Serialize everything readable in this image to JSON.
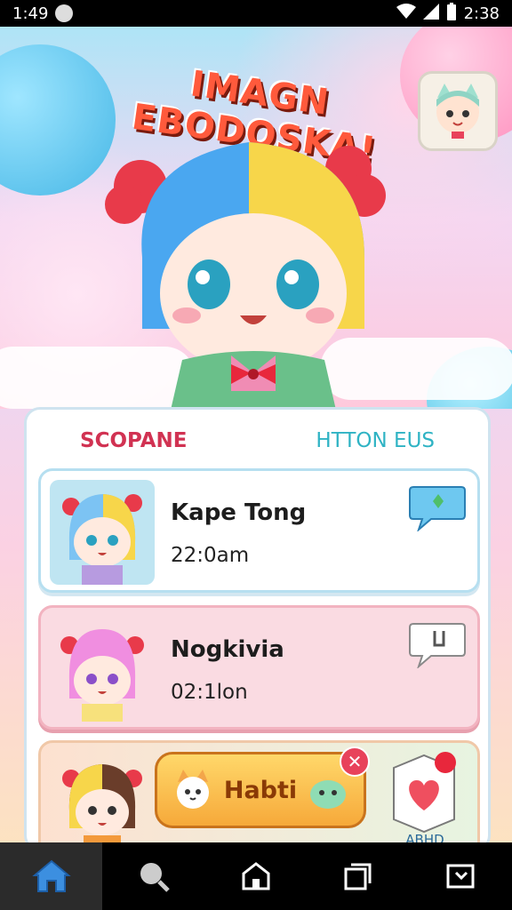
{
  "status_bar": {
    "time": "1:49",
    "time_right": "2:38"
  },
  "hero": {
    "title": "IMAGN EBODOSKA!",
    "avatar_corner_icon": "cat-avatar-icon"
  },
  "tabs": [
    {
      "label": "SCOPANE"
    },
    {
      "label": "HTTON EUS"
    }
  ],
  "items": [
    {
      "name": "Kape Tong",
      "time": "22:0am",
      "action_icon": "chat-bubble-icon"
    },
    {
      "name": "Nogkivia",
      "time": "02:1lon",
      "action_icon": "chat-bubble-icon"
    },
    {
      "button_label": "Habti",
      "badge_label": "ABHD"
    }
  ],
  "bottom_nav": [
    {
      "icon": "home-icon"
    },
    {
      "icon": "search-icon"
    },
    {
      "icon": "house-icon"
    },
    {
      "icon": "recent-apps-icon"
    },
    {
      "icon": "back-icon"
    }
  ],
  "colors": {
    "tab_active": "#d13252",
    "tab_other": "#2fb3c4",
    "habit_button": "#f6a93a"
  }
}
